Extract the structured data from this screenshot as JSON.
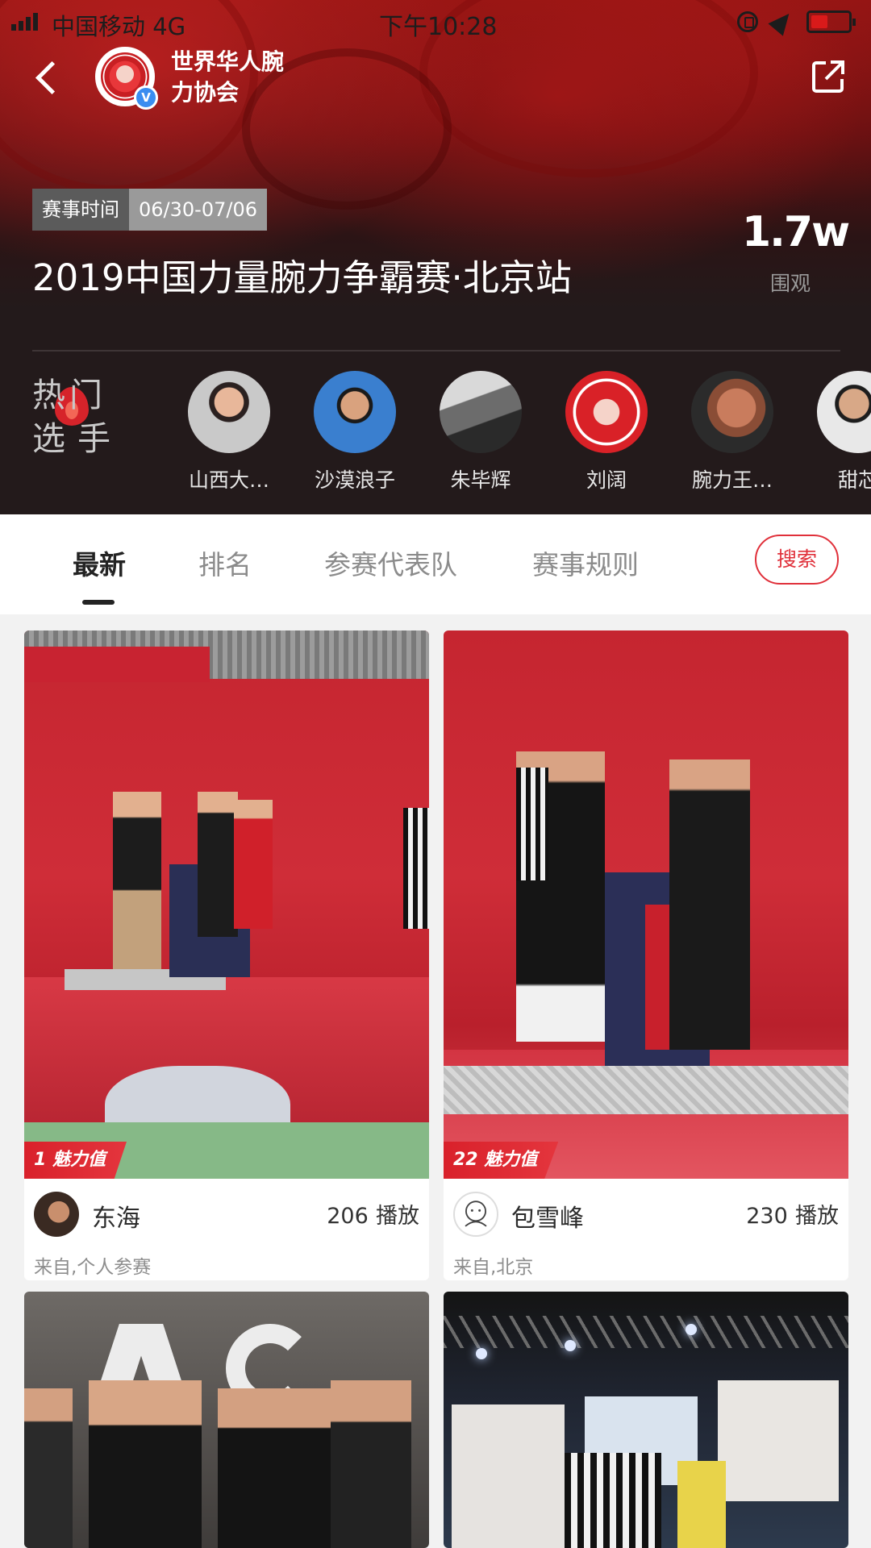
{
  "status_bar": {
    "carrier": "中国移动  4G",
    "time": "下午10:28"
  },
  "header": {
    "org_name": "世界华人腕力协会",
    "verified_mark": "V",
    "event_time_label": "赛事时间",
    "event_time_value": "06/30-07/06",
    "event_title": "2019中国力量腕力争霸赛·北京站",
    "views_count": "1.7w",
    "views_label": "围观"
  },
  "hot_players": {
    "label_chars": [
      "热",
      "门",
      "选",
      "手"
    ],
    "players": [
      {
        "name": "山西大…",
        "avatar": "avatar-photo"
      },
      {
        "name": "沙漠浪子",
        "avatar": "avatar-photo"
      },
      {
        "name": "朱毕辉",
        "avatar": "avatar-photo"
      },
      {
        "name": "刘阔",
        "avatar": "association-logo"
      },
      {
        "name": "腕力王…",
        "avatar": "avatar-photo"
      },
      {
        "name": "甜芯",
        "avatar": "avatar-photo"
      }
    ]
  },
  "tabs": [
    {
      "label": "最新",
      "active": true
    },
    {
      "label": "排名",
      "active": false
    },
    {
      "label": "参赛代表队",
      "active": false
    },
    {
      "label": "赛事规则",
      "active": false
    }
  ],
  "search_button": "搜索",
  "videos": [
    {
      "charm": "1  魅力值",
      "author": "东海",
      "plays": "206",
      "plays_unit": "播放",
      "from": "来自,个人参赛"
    },
    {
      "charm": "22  魅力值",
      "author": "包雪峰",
      "plays": "230",
      "plays_unit": "播放",
      "from": "来自,北京"
    },
    {
      "charm": "",
      "author": "",
      "plays": "",
      "plays_unit": "",
      "from": ""
    },
    {
      "charm": "",
      "author": "",
      "plays": "",
      "plays_unit": "",
      "from": ""
    }
  ],
  "colors": {
    "accent": "#e0303a",
    "header_dark": "#231a1b",
    "charm_badge": "#d9212b"
  }
}
